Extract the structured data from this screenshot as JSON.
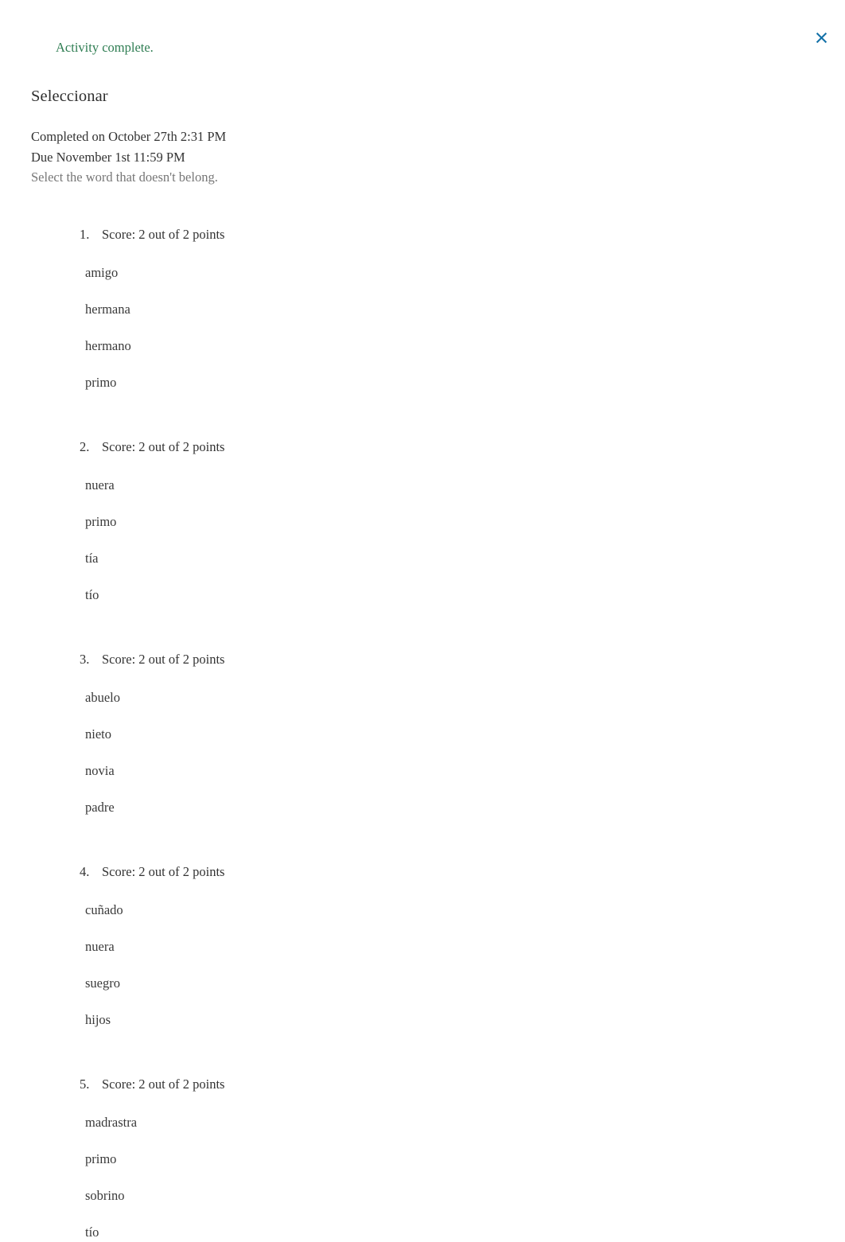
{
  "window": {
    "close_icon": "close-x-icon"
  },
  "status": {
    "text": "Activity complete.",
    "color": "#2e7d52"
  },
  "activity": {
    "title": "Seleccionar",
    "completed_on": "Completed on October 27th 2:31 PM",
    "due": "Due November 1st 11:59 PM",
    "instructions": "Select the word that doesn't belong."
  },
  "questions": [
    {
      "number": "1.",
      "score": "Score: 2 out of 2 points",
      "options": [
        "amigo",
        "hermana",
        "hermano",
        "primo"
      ]
    },
    {
      "number": "2.",
      "score": "Score: 2 out of 2 points",
      "options": [
        "nuera",
        "primo",
        "tía",
        "tío"
      ]
    },
    {
      "number": "3.",
      "score": "Score: 2 out of 2 points",
      "options": [
        "abuelo",
        "nieto",
        "novia",
        "padre"
      ]
    },
    {
      "number": "4.",
      "score": "Score: 2 out of 2 points",
      "options": [
        "cuñado",
        "nuera",
        "suegro",
        "hijos"
      ]
    },
    {
      "number": "5.",
      "score": "Score: 2 out of 2 points",
      "options": [
        "madrastra",
        "primo",
        "sobrino",
        "tío"
      ]
    }
  ]
}
